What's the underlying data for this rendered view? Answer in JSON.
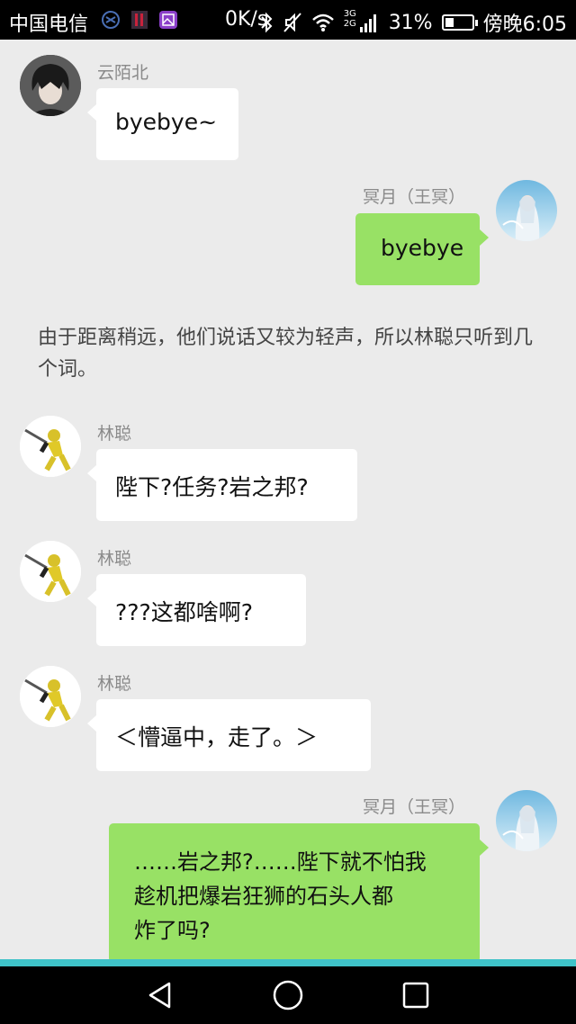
{
  "status_bar": {
    "carrier": "中国电信",
    "network_speed": "0K/s",
    "signal_types": "3G 2G",
    "battery": "31%",
    "battery_level": 0.31,
    "time": "傍晚6:05"
  },
  "messages": [
    {
      "sender": "云陌北",
      "text": "byebye~",
      "side": "left"
    },
    {
      "sender": "冥月（王冥）",
      "text": "byebye",
      "side": "right"
    },
    {
      "sender": "林聪",
      "text": "陛下?任务?岩之邦?",
      "side": "left"
    },
    {
      "sender": "林聪",
      "text": "???这都啥啊?",
      "side": "left"
    },
    {
      "sender": "林聪",
      "text": "＜懵逼中，走了。＞",
      "side": "left"
    },
    {
      "sender": "冥月（王冥）",
      "text_lines": [
        "……岩之邦?……陛下就不怕我",
        "趁机把爆岩狂狮的石头人都",
        "炸了吗?"
      ],
      "side": "right"
    }
  ],
  "narration": "由于距离稍远，他们说话又较为轻声，所以林聪只听到几个词。",
  "colors": {
    "background": "#ebebeb",
    "bubble_left": "#ffffff",
    "bubble_right": "#98e165",
    "accent_line": "#3fc2c8"
  },
  "icons": {
    "nav_back": "back-triangle-icon",
    "nav_home": "home-circle-icon",
    "nav_recent": "recent-square-icon"
  }
}
